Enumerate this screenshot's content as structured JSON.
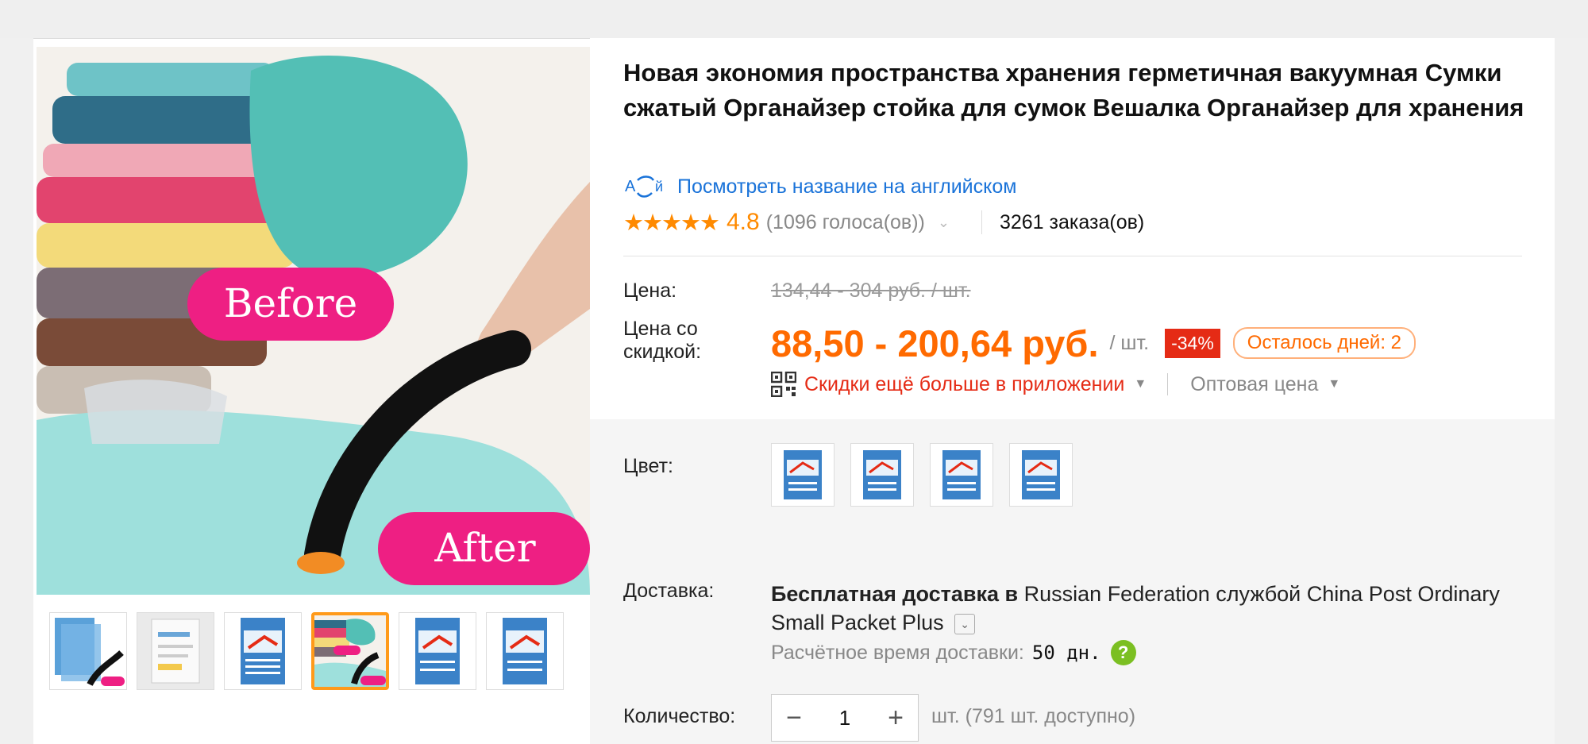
{
  "product": {
    "title": "Новая экономия пространства хранения герметичная вакуумная Сумки сжатый Органайзер стойка для сумок Вешалка Органайзер для хранения",
    "translate_link": "Посмотреть название на английском",
    "rating": {
      "stars_text": "★★★★★",
      "value": "4.8",
      "votes": "(1096 голоса(ов))",
      "orders": "3261 заказа(ов)"
    }
  },
  "gallery": {
    "main_image": {
      "before_label": "Before",
      "after_label": "After"
    },
    "thumbnails": [
      {
        "name": "thumb-1"
      },
      {
        "name": "thumb-2"
      },
      {
        "name": "thumb-3"
      },
      {
        "name": "thumb-4"
      },
      {
        "name": "thumb-5"
      },
      {
        "name": "thumb-6"
      }
    ],
    "active_thumb_index": 3
  },
  "price": {
    "label": "Цена:",
    "original": "134,44 - 304 руб. / шт.",
    "discount_label": "Цена со скидкой:",
    "discounted": "88,50 - 200,64 руб.",
    "per_unit": "/ шт.",
    "discount_badge": "-34%",
    "days_left": "Осталось дней: 2",
    "app_discount": "Скидки ещё больше в приложении",
    "wholesale": "Оптовая цена"
  },
  "color": {
    "label": "Цвет:",
    "options_count": 4
  },
  "shipping": {
    "label": "Доставка:",
    "free_text": "Бесплатная доставка в",
    "destination_service": "Russian Federation службой China Post Ordinary Small Packet Plus",
    "eta_label": "Расчётное время доставки:",
    "eta_value": "50 дн."
  },
  "quantity": {
    "label": "Количество:",
    "value": "1",
    "minus": "−",
    "plus": "+",
    "available": "шт. (791 шт. доступно)"
  },
  "colors": {
    "accent_orange": "#ff6a00",
    "badge_red": "#e52b15",
    "link_blue": "#1a73d9",
    "thumb_active": "#ff9a1a"
  }
}
